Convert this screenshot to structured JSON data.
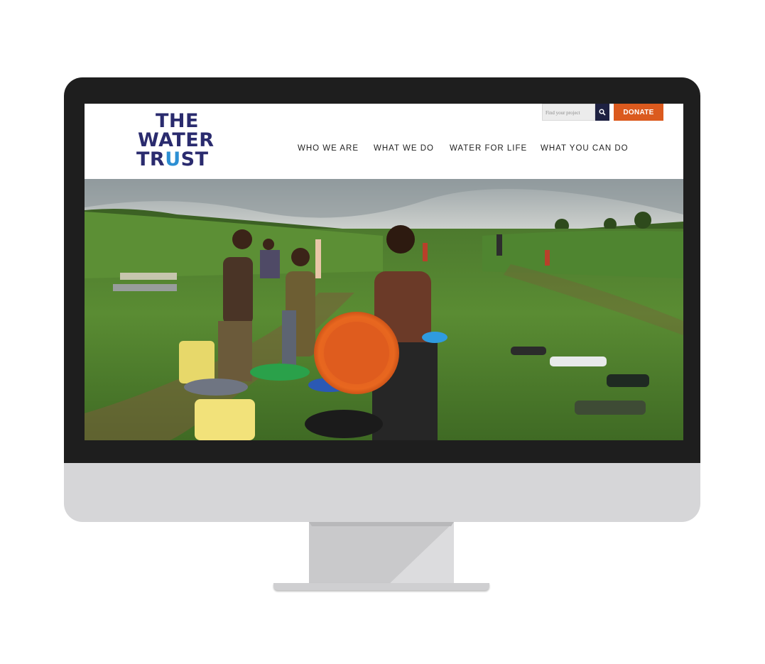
{
  "site": {
    "logo": {
      "line1": "THE",
      "line2": "WATER",
      "line3_a": "TR",
      "line3_u": "U",
      "line3_b": "ST"
    },
    "search": {
      "placeholder": "Find your project",
      "icon": "search-icon"
    },
    "donate_label": "DONATE",
    "nav": [
      {
        "label": "WHO WE ARE"
      },
      {
        "label": "WHAT WE DO"
      },
      {
        "label": "WATER FOR LIFE"
      },
      {
        "label": "WHAT YOU CAN DO"
      }
    ]
  },
  "colors": {
    "brand_navy": "#2a2b6e",
    "brand_blue": "#2c8fd3",
    "donate_orange": "#db5a1e",
    "bezel": "#1e1e1e",
    "chin": "#d6d6d8"
  }
}
